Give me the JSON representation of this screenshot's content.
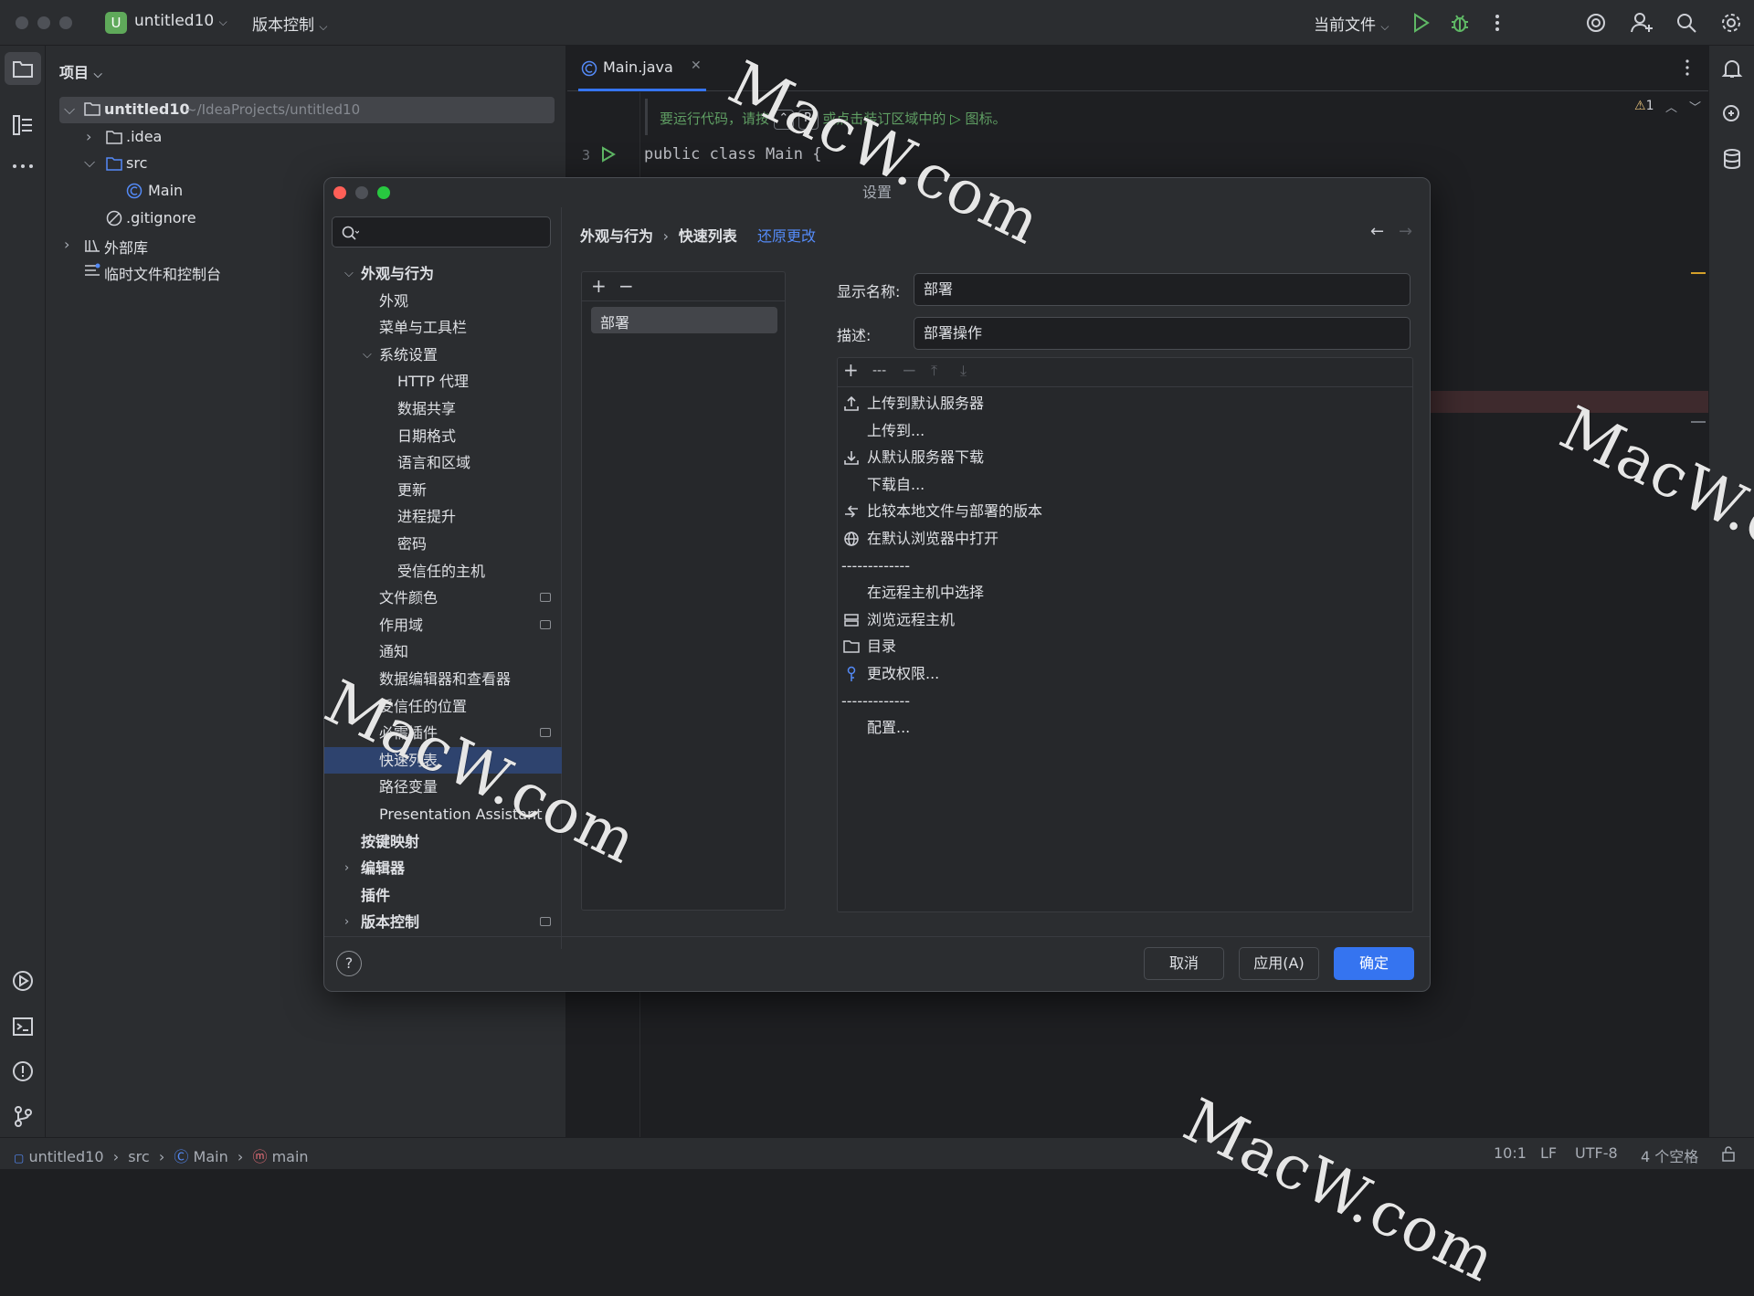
{
  "titlebar": {
    "project_badge": "U",
    "project_name": "untitled10",
    "vcs_menu": "版本控制",
    "run_config": "当前文件"
  },
  "project_panel": {
    "title": "项目",
    "root_name": "untitled10",
    "root_path": "~/IdeaProjects/untitled10",
    "items": [
      ".idea",
      "src",
      "Main",
      ".gitignore",
      "外部库",
      "临时文件和控制台"
    ]
  },
  "editor": {
    "tab": "Main.java",
    "hint_prefix": "要运行代码，请按",
    "hint_suffix": "或点击装订区域中的",
    "hint_end": "图标。",
    "line_number": "3",
    "code_line": "public class Main {",
    "warnings": "1"
  },
  "dialog": {
    "title": "设置",
    "search_placeholder": "",
    "breadcrumb_parent": "外观与行为",
    "breadcrumb_current": "快速列表",
    "revert": "还原更改",
    "nav": [
      {
        "label": "外观与行为",
        "bold": true
      },
      {
        "label": "外观"
      },
      {
        "label": "菜单与工具栏"
      },
      {
        "label": "系统设置"
      },
      {
        "label": "HTTP 代理"
      },
      {
        "label": "数据共享"
      },
      {
        "label": "日期格式"
      },
      {
        "label": "语言和区域"
      },
      {
        "label": "更新"
      },
      {
        "label": "进程提升"
      },
      {
        "label": "密码"
      },
      {
        "label": "受信任的主机"
      },
      {
        "label": "文件颜色"
      },
      {
        "label": "作用域"
      },
      {
        "label": "通知"
      },
      {
        "label": "数据编辑器和查看器"
      },
      {
        "label": "受信任的位置"
      },
      {
        "label": "必需插件"
      },
      {
        "label": "快速列表"
      },
      {
        "label": "路径变量"
      },
      {
        "label": "Presentation Assistant"
      },
      {
        "label": "按键映射",
        "bold": true
      },
      {
        "label": "编辑器",
        "bold": true
      },
      {
        "label": "插件",
        "bold": true
      },
      {
        "label": "版本控制",
        "bold": true
      }
    ],
    "list_items": [
      "部署"
    ],
    "display_name_label": "显示名称:",
    "display_name_value": "部署",
    "description_label": "描述:",
    "description_value": "部署操作",
    "toolbar_separator": "---",
    "actions": [
      {
        "label": "上传到默认服务器",
        "icon": "upload-icon"
      },
      {
        "label": "上传到...",
        "icon": ""
      },
      {
        "label": "从默认服务器下载",
        "icon": "download-icon"
      },
      {
        "label": "下载自...",
        "icon": ""
      },
      {
        "label": "比较本地文件与部署的版本",
        "icon": "compare-icon"
      },
      {
        "label": "在默认浏览器中打开",
        "icon": "globe-icon"
      },
      {
        "label": "-------------",
        "icon": "separator"
      },
      {
        "label": "在远程主机中选择",
        "icon": ""
      },
      {
        "label": "浏览远程主机",
        "icon": "server-icon"
      },
      {
        "label": "目录",
        "icon": "folder-icon"
      },
      {
        "label": "更改权限...",
        "icon": "key-icon"
      },
      {
        "label": "-------------",
        "icon": "separator"
      },
      {
        "label": "配置...",
        "icon": ""
      }
    ],
    "cancel": "取消",
    "apply": "应用(A)",
    "ok": "确定",
    "help": "?"
  },
  "statusbar": {
    "crumbs": [
      "untitled10",
      "src",
      "Main",
      "main"
    ],
    "position": "10:1",
    "line_sep": "LF",
    "encoding": "UTF-8",
    "indent": "4 个空格"
  },
  "watermark": "MacW.com",
  "colors": {
    "accent": "#3574f0",
    "selection": "#2e436e",
    "run": "#5fb865",
    "link": "#548af7"
  }
}
